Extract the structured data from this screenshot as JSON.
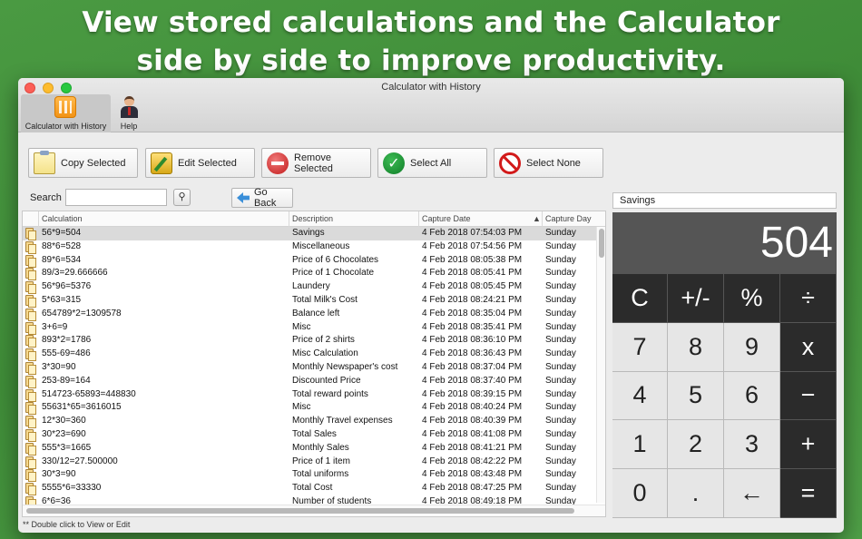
{
  "hero": {
    "line1": "View stored calculations and the Calculator",
    "line2": "side by side to improve productivity."
  },
  "window": {
    "title": "Calculator with History"
  },
  "toolbar": [
    {
      "label": "Calculator with History",
      "icon": "calculator-icon",
      "selected": true
    },
    {
      "label": "Help",
      "icon": "help-person-icon",
      "selected": false
    }
  ],
  "actions": {
    "copy": "Copy Selected",
    "edit": "Edit Selected",
    "remove": "Remove Selected",
    "select_all": "Select All",
    "select_none": "Select None"
  },
  "search": {
    "label": "Search",
    "value": "",
    "back": "Go Back"
  },
  "table": {
    "columns": [
      "Calculation",
      "Description",
      "Capture Date",
      "Capture Day"
    ],
    "sort_column": "Capture Date",
    "rows": [
      [
        "56*9=504",
        "Savings",
        "4 Feb 2018 07:54:03 PM",
        "Sunday"
      ],
      [
        "88*6=528",
        "Miscellaneous",
        "4 Feb 2018 07:54:56 PM",
        "Sunday"
      ],
      [
        "89*6=534",
        "Price of 6 Chocolates",
        "4 Feb 2018 08:05:38 PM",
        "Sunday"
      ],
      [
        "89/3=29.666666",
        "Price of 1 Chocolate",
        "4 Feb 2018 08:05:41 PM",
        "Sunday"
      ],
      [
        "56*96=5376",
        "Laundery",
        "4 Feb 2018 08:05:45 PM",
        "Sunday"
      ],
      [
        "5*63=315",
        "Total Milk's Cost",
        "4 Feb 2018 08:24:21 PM",
        "Sunday"
      ],
      [
        "654789*2=1309578",
        "Balance left",
        "4 Feb 2018 08:35:04 PM",
        "Sunday"
      ],
      [
        "3+6=9",
        "Misc",
        "4 Feb 2018 08:35:41 PM",
        "Sunday"
      ],
      [
        "893*2=1786",
        "Price of 2 shirts",
        "4 Feb 2018 08:36:10 PM",
        "Sunday"
      ],
      [
        "555-69=486",
        "Misc Calculation",
        "4 Feb 2018 08:36:43 PM",
        "Sunday"
      ],
      [
        "3*30=90",
        "Monthly Newspaper's cost",
        "4 Feb 2018 08:37:04 PM",
        "Sunday"
      ],
      [
        "253-89=164",
        "Discounted Price",
        "4 Feb 2018 08:37:40 PM",
        "Sunday"
      ],
      [
        "514723-65893=448830",
        "Total reward points",
        "4 Feb 2018 08:39:15 PM",
        "Sunday"
      ],
      [
        "55631*65=3616015",
        "Misc",
        "4 Feb 2018 08:40:24 PM",
        "Sunday"
      ],
      [
        "12*30=360",
        "Monthly Travel expenses",
        "4 Feb 2018 08:40:39 PM",
        "Sunday"
      ],
      [
        "30*23=690",
        "Total Sales",
        "4 Feb 2018 08:41:08 PM",
        "Sunday"
      ],
      [
        "555*3=1665",
        "Monthly Sales",
        "4 Feb 2018 08:41:21 PM",
        "Sunday"
      ],
      [
        "330/12=27.500000",
        "Price of 1 item",
        "4 Feb 2018 08:42:22 PM",
        "Sunday"
      ],
      [
        "30*3=90",
        "Total uniforms",
        "4 Feb 2018 08:43:48 PM",
        "Sunday"
      ],
      [
        "5555*6=33330",
        "Total Cost",
        "4 Feb 2018 08:47:25 PM",
        "Sunday"
      ],
      [
        "6*6=36",
        "Number of students",
        "4 Feb 2018 08:49:18 PM",
        "Sunday"
      ]
    ],
    "selected_index": 0
  },
  "footer_note": "** Double click to View or Edit",
  "calculator": {
    "description": "Savings",
    "display": "504",
    "keys": [
      {
        "label": "C",
        "kind": "fn",
        "name": "clear-key"
      },
      {
        "label": "+/-",
        "kind": "fn",
        "name": "sign-key"
      },
      {
        "label": "%",
        "kind": "fn",
        "name": "percent-key"
      },
      {
        "label": "÷",
        "kind": "op",
        "name": "divide-key"
      },
      {
        "label": "7",
        "kind": "num",
        "name": "digit-7-key"
      },
      {
        "label": "8",
        "kind": "num",
        "name": "digit-8-key"
      },
      {
        "label": "9",
        "kind": "num",
        "name": "digit-9-key"
      },
      {
        "label": "x",
        "kind": "op",
        "name": "multiply-key"
      },
      {
        "label": "4",
        "kind": "num",
        "name": "digit-4-key"
      },
      {
        "label": "5",
        "kind": "num",
        "name": "digit-5-key"
      },
      {
        "label": "6",
        "kind": "num",
        "name": "digit-6-key"
      },
      {
        "label": "−",
        "kind": "op",
        "name": "subtract-key"
      },
      {
        "label": "1",
        "kind": "num",
        "name": "digit-1-key"
      },
      {
        "label": "2",
        "kind": "num",
        "name": "digit-2-key"
      },
      {
        "label": "3",
        "kind": "num",
        "name": "digit-3-key"
      },
      {
        "label": "+",
        "kind": "op",
        "name": "add-key"
      },
      {
        "label": "0",
        "kind": "num",
        "name": "digit-0-key"
      },
      {
        "label": ".",
        "kind": "num",
        "name": "decimal-key"
      },
      {
        "label": "←",
        "kind": "num",
        "name": "backspace-key"
      },
      {
        "label": "=",
        "kind": "op",
        "name": "equals-key"
      }
    ]
  }
}
